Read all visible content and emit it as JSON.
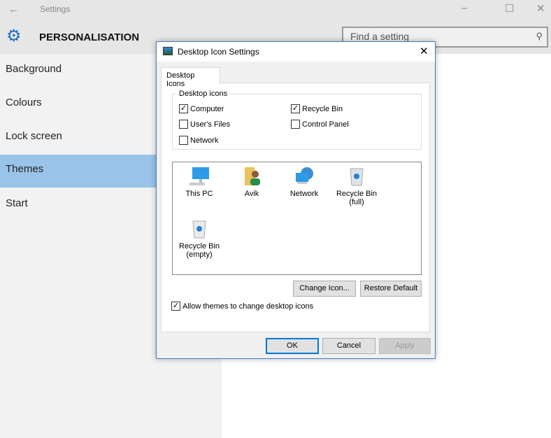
{
  "window": {
    "back_icon": "arrow-left-icon",
    "title": "Settings",
    "controls": [
      "minimize",
      "maximize",
      "close"
    ]
  },
  "header": {
    "icon": "gear-icon",
    "title": "PERSONALISATION",
    "search_placeholder": "Find a setting"
  },
  "sidebar": {
    "items": [
      {
        "label": "Background"
      },
      {
        "label": "Colours"
      },
      {
        "label": "Lock screen"
      },
      {
        "label": "Themes",
        "selected": true
      },
      {
        "label": "Start"
      }
    ]
  },
  "dialog": {
    "title": "Desktop Icon Settings",
    "tab": "Desktop Icons",
    "group_label": "Desktop icons",
    "checkboxes": [
      {
        "label": "Computer",
        "checked": true
      },
      {
        "label": "Recycle Bin",
        "checked": true
      },
      {
        "label": "User's Files",
        "checked": false
      },
      {
        "label": "Control Panel",
        "checked": false
      },
      {
        "label": "Network",
        "checked": false
      }
    ],
    "icons": [
      {
        "label": "This PC",
        "icon": "monitor-icon"
      },
      {
        "label": "Avik",
        "icon": "user-folder-icon"
      },
      {
        "label": "Network",
        "icon": "network-icon"
      },
      {
        "label": "Recycle Bin (full)",
        "icon": "recycle-bin-full-icon"
      },
      {
        "label": "Recycle Bin (empty)",
        "icon": "recycle-bin-empty-icon"
      }
    ],
    "change_icon": "Change Icon...",
    "restore_default": "Restore Default",
    "allow_themes": {
      "label": "Allow themes to change desktop icons",
      "checked": true
    },
    "ok": "OK",
    "cancel": "Cancel",
    "apply": "Apply"
  },
  "colors": {
    "accent": "#99c3e8",
    "dialog_border": "#3f7fc4"
  }
}
